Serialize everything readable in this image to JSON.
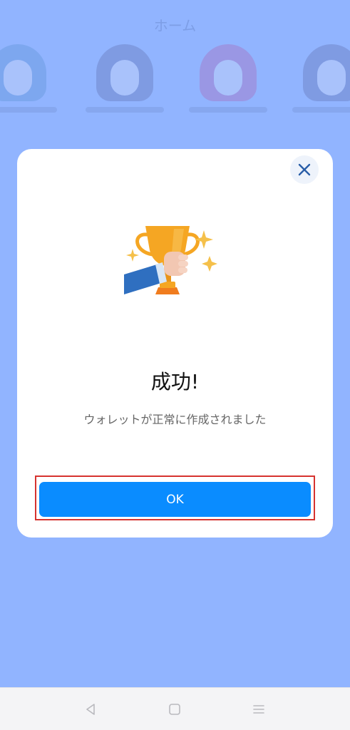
{
  "background": {
    "title": "ホーム"
  },
  "dialog": {
    "title": "成功!",
    "message": "ウォレットが正常に作成されました",
    "ok_label": "OK",
    "close_icon": "close-icon",
    "illustration": "trophy-in-hand-illustration"
  },
  "nav_bar": {
    "back_icon": "back-triangle-icon",
    "home_icon": "home-square-icon",
    "menu_icon": "menu-lines-icon"
  },
  "colors": {
    "overlay": "#91b4ff",
    "primary_button": "#0a8cff",
    "highlight_border": "#d6332f",
    "trophy": "#f5a623",
    "sparkle": "#f5c04a",
    "sleeve": "#2f6fc0"
  }
}
